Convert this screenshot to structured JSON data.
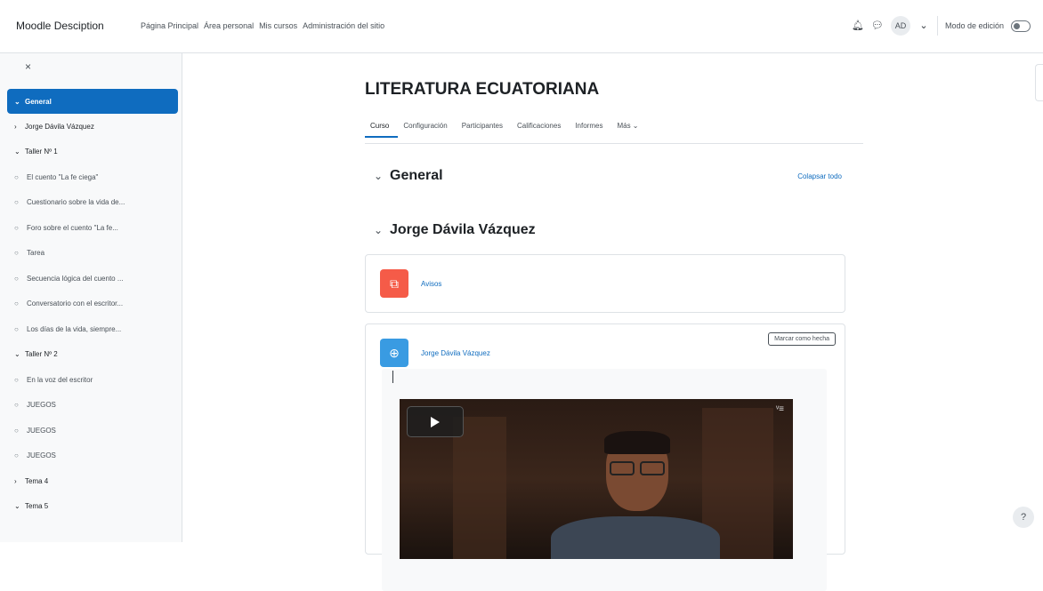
{
  "navbar": {
    "brand": "Moodle Desciption",
    "links": [
      "Página Principal",
      "Área personal",
      "Mis cursos",
      "Administración del sitio"
    ],
    "avatar_initials": "AD",
    "edit_mode_label": "Modo de edición"
  },
  "drawer": {
    "close_glyph": "×",
    "items": [
      {
        "label": "General",
        "type": "section",
        "active": true,
        "chev": "⌄",
        "icon": ""
      },
      {
        "label": "Jorge Dávila Vázquez",
        "type": "section",
        "active": false,
        "chev": "›",
        "icon": ""
      },
      {
        "label": "Taller Nº 1",
        "type": "section",
        "active": false,
        "chev": "⌄",
        "icon": ""
      },
      {
        "label": "El cuento \"La fe ciega\"",
        "type": "activity",
        "active": false,
        "chev": "",
        "icon": "○"
      },
      {
        "label": "Cuestionario sobre la vida de...",
        "type": "activity",
        "active": false,
        "chev": "",
        "icon": "○"
      },
      {
        "label": "Foro sobre el cuento \"La fe...",
        "type": "activity",
        "active": false,
        "chev": "",
        "icon": "○"
      },
      {
        "label": "Tarea",
        "type": "activity",
        "active": false,
        "chev": "",
        "icon": "○"
      },
      {
        "label": "Secuencia lógica del cuento ...",
        "type": "activity",
        "active": false,
        "chev": "",
        "icon": "○"
      },
      {
        "label": "Conversatorio con el escritor...",
        "type": "activity",
        "active": false,
        "chev": "",
        "icon": "○"
      },
      {
        "label": "Los días de la vida, siempre...",
        "type": "activity",
        "active": false,
        "chev": "",
        "icon": "○"
      },
      {
        "label": "Taller Nº 2",
        "type": "section",
        "active": false,
        "chev": "⌄",
        "icon": ""
      },
      {
        "label": "En la voz del escritor",
        "type": "activity",
        "active": false,
        "chev": "",
        "icon": "○"
      },
      {
        "label": "JUEGOS",
        "type": "activity",
        "active": false,
        "chev": "",
        "icon": "○"
      },
      {
        "label": "JUEGOS",
        "type": "activity",
        "active": false,
        "chev": "",
        "icon": "○"
      },
      {
        "label": "JUEGOS",
        "type": "activity",
        "active": false,
        "chev": "",
        "icon": "○"
      },
      {
        "label": "Tema 4",
        "type": "section",
        "active": false,
        "chev": "›",
        "icon": ""
      },
      {
        "label": "Tema 5",
        "type": "section",
        "active": false,
        "chev": "⌄",
        "icon": ""
      }
    ]
  },
  "course": {
    "title": "LITERATURA ECUATORIANA",
    "tabs": [
      "Curso",
      "Configuración",
      "Participantes",
      "Calificaciones",
      "Informes",
      "Más ⌄"
    ]
  },
  "sections": {
    "general": {
      "name": "General",
      "collapse_all": "Colapsar todo"
    },
    "jorge": {
      "name": "Jorge Dávila Vázquez"
    }
  },
  "activities": {
    "first": {
      "name": "Avisos",
      "icon": "⧉",
      "color": "#f55b48"
    },
    "second": {
      "name": "Jorge Dávila Vázquez",
      "icon": "⊕",
      "color": "#399be2",
      "mark_done": "Marcar como hecha"
    }
  },
  "video": {
    "logo": "ᵛ≡"
  },
  "help": {
    "glyph": "?"
  },
  "colors": {
    "accent": "#0f6cbf"
  }
}
